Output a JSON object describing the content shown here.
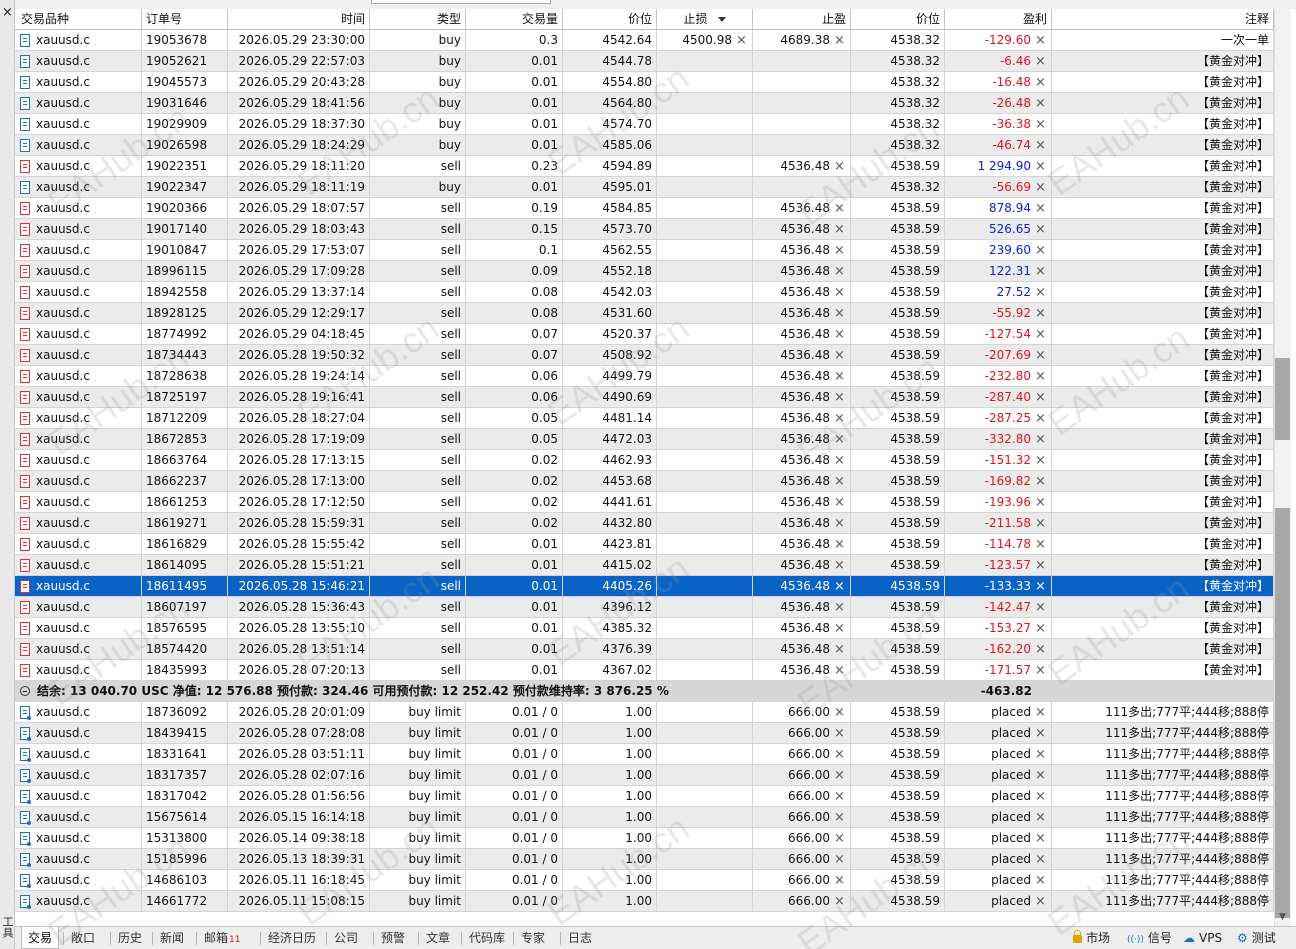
{
  "window": {
    "close_icon": "×",
    "panel_label": "工具箱"
  },
  "columns": [
    "交易品种",
    "订单号",
    "时间",
    "类型",
    "交易量",
    "价位",
    "止损",
    "止盈",
    "价位",
    "盈利",
    "注释"
  ],
  "trades": [
    {
      "symbol": "xauusd.c",
      "ticket": "19053678",
      "time": "2026.05.29 23:30:00",
      "type": "buy",
      "volume": "0.3",
      "price": "4542.64",
      "sl": "4500.98",
      "tp": "4689.38",
      "current": "4538.32",
      "profit": "-129.60",
      "comment": "一次一单"
    },
    {
      "symbol": "xauusd.c",
      "ticket": "19052621",
      "time": "2026.05.29 22:57:03",
      "type": "buy",
      "volume": "0.01",
      "price": "4544.78",
      "sl": "",
      "tp": "",
      "current": "4538.32",
      "profit": "-6.46",
      "comment": "【黄金对冲】"
    },
    {
      "symbol": "xauusd.c",
      "ticket": "19045573",
      "time": "2026.05.29 20:43:28",
      "type": "buy",
      "volume": "0.01",
      "price": "4554.80",
      "sl": "",
      "tp": "",
      "current": "4538.32",
      "profit": "-16.48",
      "comment": "【黄金对冲】"
    },
    {
      "symbol": "xauusd.c",
      "ticket": "19031646",
      "time": "2026.05.29 18:41:56",
      "type": "buy",
      "volume": "0.01",
      "price": "4564.80",
      "sl": "",
      "tp": "",
      "current": "4538.32",
      "profit": "-26.48",
      "comment": "【黄金对冲】"
    },
    {
      "symbol": "xauusd.c",
      "ticket": "19029909",
      "time": "2026.05.29 18:37:30",
      "type": "buy",
      "volume": "0.01",
      "price": "4574.70",
      "sl": "",
      "tp": "",
      "current": "4538.32",
      "profit": "-36.38",
      "comment": "【黄金对冲】"
    },
    {
      "symbol": "xauusd.c",
      "ticket": "19026598",
      "time": "2026.05.29 18:24:29",
      "type": "buy",
      "volume": "0.01",
      "price": "4585.06",
      "sl": "",
      "tp": "",
      "current": "4538.32",
      "profit": "-46.74",
      "comment": "【黄金对冲】"
    },
    {
      "symbol": "xauusd.c",
      "ticket": "19022351",
      "time": "2026.05.29 18:11:20",
      "type": "sell",
      "volume": "0.23",
      "price": "4594.89",
      "sl": "",
      "tp": "4536.48",
      "current": "4538.59",
      "profit": "1 294.90",
      "comment": "【黄金对冲】"
    },
    {
      "symbol": "xauusd.c",
      "ticket": "19022347",
      "time": "2026.05.29 18:11:19",
      "type": "buy",
      "volume": "0.01",
      "price": "4595.01",
      "sl": "",
      "tp": "",
      "current": "4538.32",
      "profit": "-56.69",
      "comment": "【黄金对冲】"
    },
    {
      "symbol": "xauusd.c",
      "ticket": "19020366",
      "time": "2026.05.29 18:07:57",
      "type": "sell",
      "volume": "0.19",
      "price": "4584.85",
      "sl": "",
      "tp": "4536.48",
      "current": "4538.59",
      "profit": "878.94",
      "comment": "【黄金对冲】"
    },
    {
      "symbol": "xauusd.c",
      "ticket": "19017140",
      "time": "2026.05.29 18:03:43",
      "type": "sell",
      "volume": "0.15",
      "price": "4573.70",
      "sl": "",
      "tp": "4536.48",
      "current": "4538.59",
      "profit": "526.65",
      "comment": "【黄金对冲】"
    },
    {
      "symbol": "xauusd.c",
      "ticket": "19010847",
      "time": "2026.05.29 17:53:07",
      "type": "sell",
      "volume": "0.1",
      "price": "4562.55",
      "sl": "",
      "tp": "4536.48",
      "current": "4538.59",
      "profit": "239.60",
      "comment": "【黄金对冲】"
    },
    {
      "symbol": "xauusd.c",
      "ticket": "18996115",
      "time": "2026.05.29 17:09:28",
      "type": "sell",
      "volume": "0.09",
      "price": "4552.18",
      "sl": "",
      "tp": "4536.48",
      "current": "4538.59",
      "profit": "122.31",
      "comment": "【黄金对冲】"
    },
    {
      "symbol": "xauusd.c",
      "ticket": "18942558",
      "time": "2026.05.29 13:37:14",
      "type": "sell",
      "volume": "0.08",
      "price": "4542.03",
      "sl": "",
      "tp": "4536.48",
      "current": "4538.59",
      "profit": "27.52",
      "comment": "【黄金对冲】"
    },
    {
      "symbol": "xauusd.c",
      "ticket": "18928125",
      "time": "2026.05.29 12:29:17",
      "type": "sell",
      "volume": "0.08",
      "price": "4531.60",
      "sl": "",
      "tp": "4536.48",
      "current": "4538.59",
      "profit": "-55.92",
      "comment": "【黄金对冲】"
    },
    {
      "symbol": "xauusd.c",
      "ticket": "18774992",
      "time": "2026.05.29 04:18:45",
      "type": "sell",
      "volume": "0.07",
      "price": "4520.37",
      "sl": "",
      "tp": "4536.48",
      "current": "4538.59",
      "profit": "-127.54",
      "comment": "【黄金对冲】"
    },
    {
      "symbol": "xauusd.c",
      "ticket": "18734443",
      "time": "2026.05.28 19:50:32",
      "type": "sell",
      "volume": "0.07",
      "price": "4508.92",
      "sl": "",
      "tp": "4536.48",
      "current": "4538.59",
      "profit": "-207.69",
      "comment": "【黄金对冲】"
    },
    {
      "symbol": "xauusd.c",
      "ticket": "18728638",
      "time": "2026.05.28 19:24:14",
      "type": "sell",
      "volume": "0.06",
      "price": "4499.79",
      "sl": "",
      "tp": "4536.48",
      "current": "4538.59",
      "profit": "-232.80",
      "comment": "【黄金对冲】"
    },
    {
      "symbol": "xauusd.c",
      "ticket": "18725197",
      "time": "2026.05.28 19:16:41",
      "type": "sell",
      "volume": "0.06",
      "price": "4490.69",
      "sl": "",
      "tp": "4536.48",
      "current": "4538.59",
      "profit": "-287.40",
      "comment": "【黄金对冲】"
    },
    {
      "symbol": "xauusd.c",
      "ticket": "18712209",
      "time": "2026.05.28 18:27:04",
      "type": "sell",
      "volume": "0.05",
      "price": "4481.14",
      "sl": "",
      "tp": "4536.48",
      "current": "4538.59",
      "profit": "-287.25",
      "comment": "【黄金对冲】"
    },
    {
      "symbol": "xauusd.c",
      "ticket": "18672853",
      "time": "2026.05.28 17:19:09",
      "type": "sell",
      "volume": "0.05",
      "price": "4472.03",
      "sl": "",
      "tp": "4536.48",
      "current": "4538.59",
      "profit": "-332.80",
      "comment": "【黄金对冲】"
    },
    {
      "symbol": "xauusd.c",
      "ticket": "18663764",
      "time": "2026.05.28 17:13:15",
      "type": "sell",
      "volume": "0.02",
      "price": "4462.93",
      "sl": "",
      "tp": "4536.48",
      "current": "4538.59",
      "profit": "-151.32",
      "comment": "【黄金对冲】"
    },
    {
      "symbol": "xauusd.c",
      "ticket": "18662237",
      "time": "2026.05.28 17:13:00",
      "type": "sell",
      "volume": "0.02",
      "price": "4453.68",
      "sl": "",
      "tp": "4536.48",
      "current": "4538.59",
      "profit": "-169.82",
      "comment": "【黄金对冲】"
    },
    {
      "symbol": "xauusd.c",
      "ticket": "18661253",
      "time": "2026.05.28 17:12:50",
      "type": "sell",
      "volume": "0.02",
      "price": "4441.61",
      "sl": "",
      "tp": "4536.48",
      "current": "4538.59",
      "profit": "-193.96",
      "comment": "【黄金对冲】"
    },
    {
      "symbol": "xauusd.c",
      "ticket": "18619271",
      "time": "2026.05.28 15:59:31",
      "type": "sell",
      "volume": "0.02",
      "price": "4432.80",
      "sl": "",
      "tp": "4536.48",
      "current": "4538.59",
      "profit": "-211.58",
      "comment": "【黄金对冲】"
    },
    {
      "symbol": "xauusd.c",
      "ticket": "18616829",
      "time": "2026.05.28 15:55:42",
      "type": "sell",
      "volume": "0.01",
      "price": "4423.81",
      "sl": "",
      "tp": "4536.48",
      "current": "4538.59",
      "profit": "-114.78",
      "comment": "【黄金对冲】"
    },
    {
      "symbol": "xauusd.c",
      "ticket": "18614095",
      "time": "2026.05.28 15:51:21",
      "type": "sell",
      "volume": "0.01",
      "price": "4415.02",
      "sl": "",
      "tp": "4536.48",
      "current": "4538.59",
      "profit": "-123.57",
      "comment": "【黄金对冲】"
    },
    {
      "symbol": "xauusd.c",
      "ticket": "18611495",
      "time": "2026.05.28 15:46:21",
      "type": "sell",
      "volume": "0.01",
      "price": "4405.26",
      "sl": "",
      "tp": "4536.48",
      "current": "4538.59",
      "profit": "-133.33",
      "comment": "【黄金对冲】",
      "selected": true
    },
    {
      "symbol": "xauusd.c",
      "ticket": "18607197",
      "time": "2026.05.28 15:36:43",
      "type": "sell",
      "volume": "0.01",
      "price": "4396.12",
      "sl": "",
      "tp": "4536.48",
      "current": "4538.59",
      "profit": "-142.47",
      "comment": "【黄金对冲】"
    },
    {
      "symbol": "xauusd.c",
      "ticket": "18576595",
      "time": "2026.05.28 13:55:10",
      "type": "sell",
      "volume": "0.01",
      "price": "4385.32",
      "sl": "",
      "tp": "4536.48",
      "current": "4538.59",
      "profit": "-153.27",
      "comment": "【黄金对冲】"
    },
    {
      "symbol": "xauusd.c",
      "ticket": "18574420",
      "time": "2026.05.28 13:51:14",
      "type": "sell",
      "volume": "0.01",
      "price": "4376.39",
      "sl": "",
      "tp": "4536.48",
      "current": "4538.59",
      "profit": "-162.20",
      "comment": "【黄金对冲】"
    },
    {
      "symbol": "xauusd.c",
      "ticket": "18435993",
      "time": "2026.05.28 07:20:13",
      "type": "sell",
      "volume": "0.01",
      "price": "4367.02",
      "sl": "",
      "tp": "4536.48",
      "current": "4538.59",
      "profit": "-171.57",
      "comment": "【黄金对冲】"
    }
  ],
  "summary": {
    "text": "结余: 13 040.70 USC  净值: 12 576.88  预付款: 324.46  可用预付款: 12 252.42  预付款维持率: 3 876.25 %",
    "total": "-463.82"
  },
  "orders": [
    {
      "symbol": "xauusd.c",
      "ticket": "18736092",
      "time": "2026.05.28 20:01:09",
      "type": "buy limit",
      "volume": "0.01 / 0",
      "price": "1.00",
      "sl": "",
      "tp": "666.00",
      "current": "4538.59",
      "status": "placed",
      "comment": "111多出;777平;444移;888停"
    },
    {
      "symbol": "xauusd.c",
      "ticket": "18439415",
      "time": "2026.05.28 07:28:08",
      "type": "buy limit",
      "volume": "0.01 / 0",
      "price": "1.00",
      "sl": "",
      "tp": "666.00",
      "current": "4538.59",
      "status": "placed",
      "comment": "111多出;777平;444移;888停"
    },
    {
      "symbol": "xauusd.c",
      "ticket": "18331641",
      "time": "2026.05.28 03:51:11",
      "type": "buy limit",
      "volume": "0.01 / 0",
      "price": "1.00",
      "sl": "",
      "tp": "666.00",
      "current": "4538.59",
      "status": "placed",
      "comment": "111多出;777平;444移;888停"
    },
    {
      "symbol": "xauusd.c",
      "ticket": "18317357",
      "time": "2026.05.28 02:07:16",
      "type": "buy limit",
      "volume": "0.01 / 0",
      "price": "1.00",
      "sl": "",
      "tp": "666.00",
      "current": "4538.59",
      "status": "placed",
      "comment": "111多出;777平;444移;888停"
    },
    {
      "symbol": "xauusd.c",
      "ticket": "18317042",
      "time": "2026.05.28 01:56:56",
      "type": "buy limit",
      "volume": "0.01 / 0",
      "price": "1.00",
      "sl": "",
      "tp": "666.00",
      "current": "4538.59",
      "status": "placed",
      "comment": "111多出;777平;444移;888停"
    },
    {
      "symbol": "xauusd.c",
      "ticket": "15675614",
      "time": "2026.05.15 16:14:18",
      "type": "buy limit",
      "volume": "0.01 / 0",
      "price": "1.00",
      "sl": "",
      "tp": "666.00",
      "current": "4538.59",
      "status": "placed",
      "comment": "111多出;777平;444移;888停"
    },
    {
      "symbol": "xauusd.c",
      "ticket": "15313800",
      "time": "2026.05.14 09:38:18",
      "type": "buy limit",
      "volume": "0.01 / 0",
      "price": "1.00",
      "sl": "",
      "tp": "666.00",
      "current": "4538.59",
      "status": "placed",
      "comment": "111多出;777平;444移;888停"
    },
    {
      "symbol": "xauusd.c",
      "ticket": "15185996",
      "time": "2026.05.13 18:39:31",
      "type": "buy limit",
      "volume": "0.01 / 0",
      "price": "1.00",
      "sl": "",
      "tp": "666.00",
      "current": "4538.59",
      "status": "placed",
      "comment": "111多出;777平;444移;888停"
    },
    {
      "symbol": "xauusd.c",
      "ticket": "14686103",
      "time": "2026.05.11 16:18:45",
      "type": "buy limit",
      "volume": "0.01 / 0",
      "price": "1.00",
      "sl": "",
      "tp": "666.00",
      "current": "4538.59",
      "status": "placed",
      "comment": "111多出;777平;444移;888停"
    },
    {
      "symbol": "xauusd.c",
      "ticket": "14661772",
      "time": "2026.05.11 15:08:15",
      "type": "buy limit",
      "volume": "0.01 / 0",
      "price": "1.00",
      "sl": "",
      "tp": "666.00",
      "current": "4538.59",
      "status": "placed",
      "comment": "111多出;777平;444移;888停"
    }
  ],
  "tabs": [
    {
      "label": "交易",
      "active": true
    },
    {
      "label": "敞口"
    },
    {
      "label": "历史"
    },
    {
      "label": "新闻"
    },
    {
      "label": "邮箱",
      "badge": "11"
    },
    {
      "label": "经济日历"
    },
    {
      "label": "公司"
    },
    {
      "label": "预警"
    },
    {
      "label": "文章"
    },
    {
      "label": "代码库"
    },
    {
      "label": "专家"
    },
    {
      "label": "日志"
    }
  ],
  "status_right": [
    {
      "label": "市场",
      "icon": "lock-icon"
    },
    {
      "label": "信号",
      "icon": "signal-icon"
    },
    {
      "label": "VPS",
      "icon": "cloud-icon"
    },
    {
      "label": "测试",
      "icon": "gear-icon"
    }
  ],
  "watermark": "EAHub.cn",
  "colors": {
    "selected_row": "#0a64c8",
    "negative": "#e0141e",
    "positive": "#0a22d6",
    "alt_row": "#ebebeb",
    "summary_row": "#d6d6d6"
  }
}
